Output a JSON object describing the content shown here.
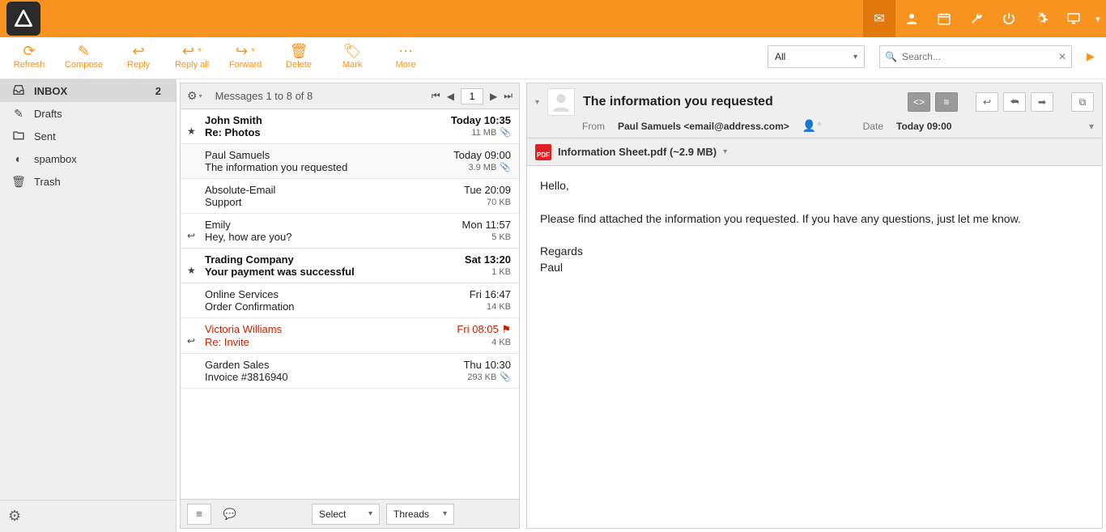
{
  "header_icons": [
    "envelope",
    "user",
    "calendar",
    "wrench",
    "power",
    "gear",
    "monitor",
    "caret"
  ],
  "toolbar": {
    "refresh": "Refresh",
    "compose": "Compose",
    "reply": "Reply",
    "reply_all": "Reply all",
    "forward": "Forward",
    "delete": "Delete",
    "mark": "Mark",
    "more": "More",
    "filter": "All",
    "search_placeholder": "Search..."
  },
  "folders": [
    {
      "icon": "inbox",
      "label": "INBOX",
      "count": "2",
      "selected": true
    },
    {
      "icon": "pencil",
      "label": "Drafts"
    },
    {
      "icon": "folder",
      "label": "Sent"
    },
    {
      "icon": "spam",
      "label": "spambox"
    },
    {
      "icon": "trash",
      "label": "Trash"
    }
  ],
  "list": {
    "title": "Messages 1 to 8 of 8",
    "page": "1",
    "footer": {
      "select_label": "Select",
      "threads_label": "Threads"
    }
  },
  "messages": [
    {
      "from": "John Smith",
      "date": "Today 10:35",
      "subject": "Re: Photos",
      "size": "11 MB",
      "attach": true,
      "unread": true,
      "lead": "star"
    },
    {
      "from": "Paul Samuels",
      "date": "Today 09:00",
      "subject": "The information you requested",
      "size": "3.9 MB",
      "attach": true,
      "selected": true
    },
    {
      "from": "Absolute-Email",
      "date": "Tue 20:09",
      "subject": "Support",
      "size": "70 KB"
    },
    {
      "from": "Emily",
      "date": "Mon 11:57",
      "subject": "Hey, how are you?",
      "size": "5 KB",
      "lead": "reply"
    },
    {
      "from": "Trading Company",
      "date": "Sat 13:20",
      "subject": "Your payment was successful",
      "size": "1 KB",
      "unread": true,
      "lead": "star"
    },
    {
      "from": "Online Services",
      "date": "Fri 16:47",
      "subject": "Order Confirmation",
      "size": "14 KB"
    },
    {
      "from": "Victoria Williams",
      "date": "Fri 08:05",
      "subject": "Re: Invite",
      "size": "4 KB",
      "flagged": true,
      "lead": "reply",
      "flagicon": true
    },
    {
      "from": "Garden Sales",
      "date": "Thu 10:30",
      "subject": "Invoice #3816940",
      "size": "293 KB",
      "attach": true
    }
  ],
  "preview": {
    "subject": "The information you requested",
    "from_label": "From",
    "from_value": "Paul Samuels <email@address.com>",
    "date_label": "Date",
    "date_value": "Today 09:00",
    "attachment": "Information Sheet.pdf (~2.9 MB)",
    "body": "Hello,\n\nPlease find attached the information you requested. If you have any questions, just let me know.\n\nRegards\nPaul"
  }
}
